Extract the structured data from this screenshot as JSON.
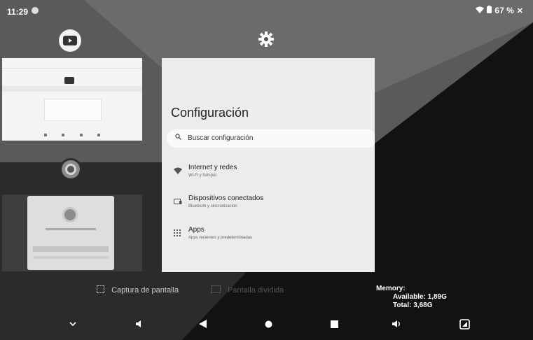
{
  "status_bar": {
    "time": "11:29",
    "battery": "67 %"
  },
  "recents": {
    "settings_card": {
      "title": "Configuración",
      "search_placeholder": "Buscar configuración",
      "items": [
        {
          "title": "Internet y redes",
          "subtitle": "Wi-Fi y hotspot",
          "icon": "wifi-icon"
        },
        {
          "title": "Dispositivos conectados",
          "subtitle": "Bluetooth y sincronización",
          "icon": "devices-icon"
        },
        {
          "title": "Apps",
          "subtitle": "Apps recientes y predeterminadas",
          "icon": "apps-icon"
        }
      ]
    },
    "youtube_card": {
      "app": "YouTube"
    },
    "chrome_card": {
      "app": "Chrome"
    }
  },
  "actions": {
    "screenshot_label": "Captura de pantalla",
    "split_label": "Pantalla dividida"
  },
  "memory": {
    "label": "Memory:",
    "available": "Available: 1,89G",
    "total": "Total: 3,68G"
  },
  "colors": {
    "background": "#1b1b1b",
    "card": "#ececec",
    "text": "#ffffff"
  }
}
